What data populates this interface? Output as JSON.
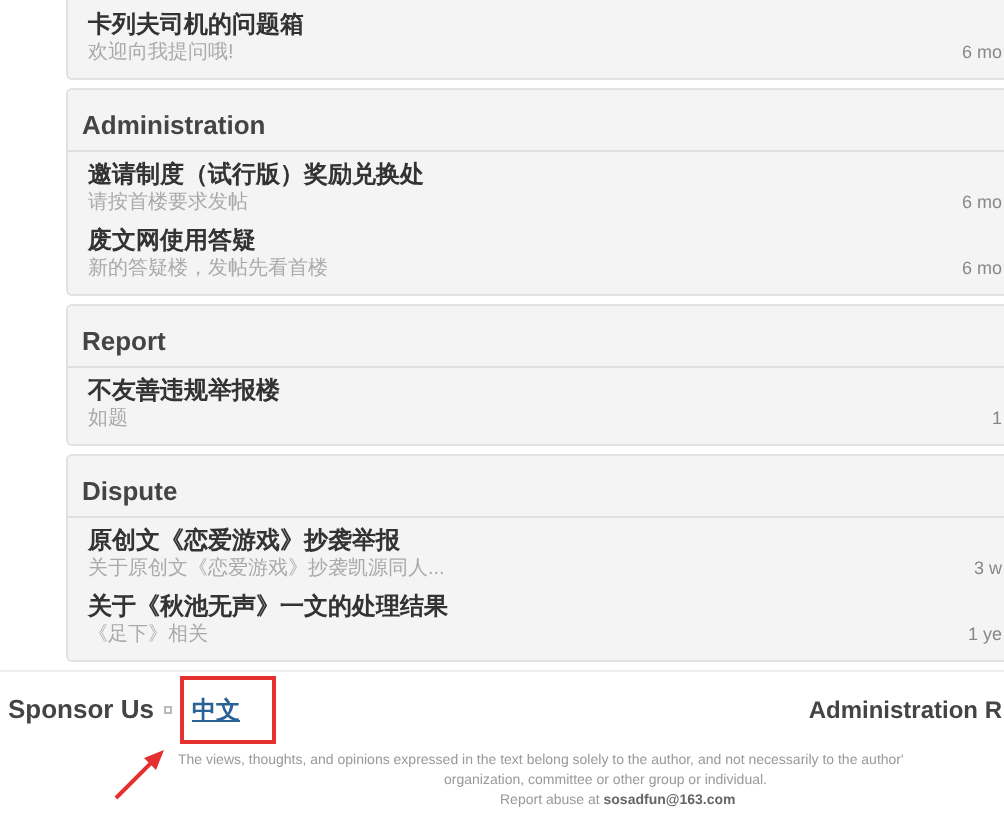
{
  "sections": [
    {
      "threads": [
        {
          "title": "卡列夫司机的问题箱",
          "subtitle": "欢迎向我提问哦!",
          "time": "6 mo"
        }
      ]
    },
    {
      "heading": "Administration",
      "threads": [
        {
          "title": "邀请制度（试行版）奖励兑换处",
          "subtitle": "请按首楼要求发帖",
          "time": "6 mo"
        },
        {
          "title": "废文网使用答疑",
          "subtitle": "新的答疑楼，发帖先看首楼",
          "time": "6 mo"
        }
      ]
    },
    {
      "heading": "Report",
      "threads": [
        {
          "title": "不友善违规举报楼",
          "subtitle": "如题",
          "time": "1"
        }
      ]
    },
    {
      "heading": "Dispute",
      "threads": [
        {
          "title": "原创文《恋爱游戏》抄袭举报",
          "subtitle": "关于原创文《恋爱游戏》抄袭凯源同人...",
          "time": "3 w"
        },
        {
          "title": "关于《秋池无声》一文的处理结果",
          "subtitle": "《足下》相关",
          "time": "1 ye"
        }
      ]
    }
  ],
  "footer": {
    "sponsor": "Sponsor Us",
    "language_link": "中文",
    "language_highlighted": true,
    "right_heading": "Administration R",
    "disclaimer": [
      "The views, thoughts, and opinions expressed in the text belong solely to the author, and not necessarily to the author'",
      "organization, committee or other group or individual."
    ],
    "report_label": "Report abuse at",
    "report_email": "sosadfun@163.com"
  }
}
